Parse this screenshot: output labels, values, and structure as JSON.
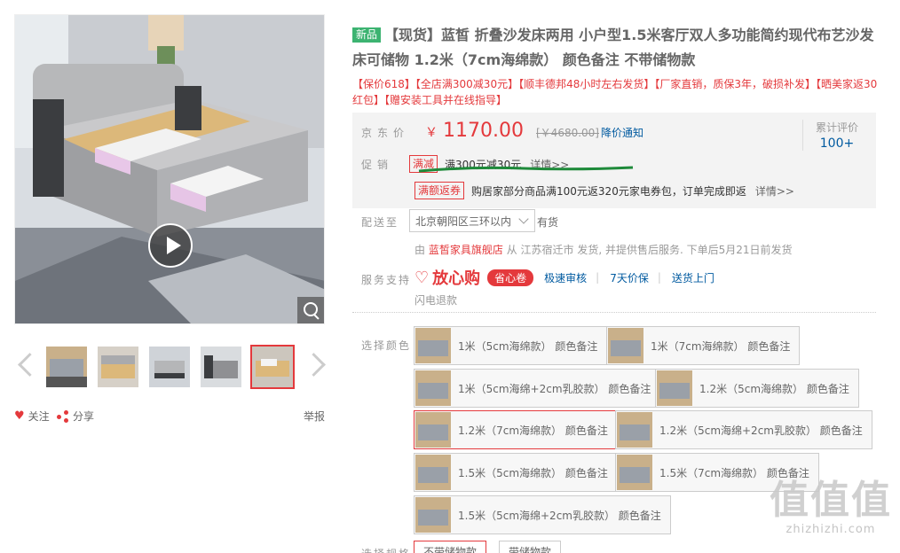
{
  "gallery": {
    "thumb_count": 5,
    "active_thumb": 4
  },
  "actions": {
    "follow": "关注",
    "share": "分享",
    "report": "举报"
  },
  "product": {
    "tag_new": "新品",
    "title": "【现货】蓝皙 折叠沙发床两用 小户型1.5米客厅双人多功能简约现代布艺沙发床可储物 1.2米（7cm海绵款） 颜色备注 不带储物款",
    "subtitle": "【保价618】【全店满300减30元】【顺丰德邦48小时左右发货】【厂家直销，质保3年，破损补发】【晒美家返30红包】【赠安装工具并在线指导】"
  },
  "price": {
    "label": "京东价",
    "currency": "￥",
    "value": "1170.00",
    "original": "[￥4680.00]",
    "notice": "降价通知",
    "review_label": "累计评价",
    "review_count": "100+"
  },
  "promotion": {
    "label": "促销",
    "tag1": "满减",
    "text1": "满300元减30元",
    "more1": "详情>>",
    "tag2": "满额返券",
    "text2": "购居家部分商品满100元返320元家电券包，订单完成即返",
    "more2": "详情>>"
  },
  "delivery": {
    "label": "配送至",
    "address": "北京朝阳区三环以内",
    "stock": "有货",
    "shipper_prefix": "由",
    "shop": "蓝皙家具旗舰店",
    "shipper_text": "从 江苏宿迁市 发货, 并提供售后服务. 下单后5月21日前发货"
  },
  "service": {
    "label": "服务支持",
    "fangxin": "放心购",
    "shengxin": "省心卷",
    "items": [
      "极速审核",
      "7天价保",
      "送货上门"
    ],
    "flash_refund": "闪电退款"
  },
  "color": {
    "label": "选择颜色",
    "options": [
      "1米（5cm海绵款） 颜色备注",
      "1米（7cm海绵款） 颜色备注",
      "1米（5cm海绵+2cm乳胶款） 颜色备注",
      "1.2米（5cm海绵款） 颜色备注",
      "1.2米（7cm海绵款） 颜色备注",
      "1.2米（5cm海绵+2cm乳胶款） 颜色备注",
      "1.5米（5cm海绵款） 颜色备注",
      "1.5米（7cm海绵款） 颜色备注",
      "1.5米（5cm海绵+2cm乳胶款） 颜色备注"
    ],
    "selected_index": 4
  },
  "spec": {
    "label": "选择规格",
    "options": [
      "不带储物款",
      "带储物款"
    ]
  },
  "watermark": {
    "big": "值值值",
    "small": "zhizhizhi.com"
  },
  "colors": {
    "accent": "#e4393c",
    "link": "#005aa0",
    "new_tag": "#3cb371"
  }
}
